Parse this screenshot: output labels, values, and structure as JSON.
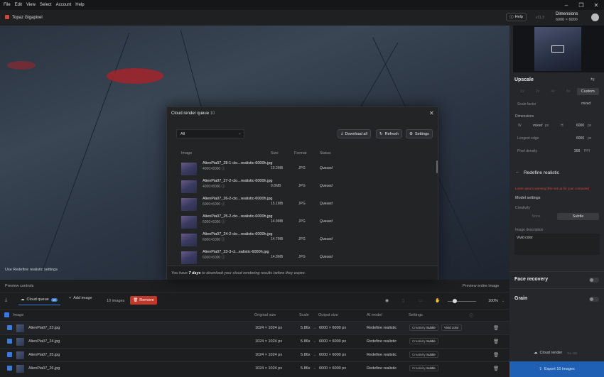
{
  "menu": [
    "File",
    "Edit",
    "View",
    "Select",
    "Account",
    "Help"
  ],
  "app": {
    "name": "Topaz Gigapixel",
    "help": "Help",
    "version": "v11.3",
    "dim_label": "Dimensions",
    "dim_value": "6000 × 6000"
  },
  "canvas": {
    "hint": "Use Redefine realistic settings"
  },
  "dialog": {
    "title": "Cloud render queue",
    "count": "10",
    "filter": "All",
    "download_all": "Download all",
    "refresh": "Refresh",
    "settings": "Settings",
    "columns": {
      "image": "Image",
      "size": "Size",
      "format": "Format",
      "status": "Status"
    },
    "items": [
      {
        "name": "AlienPia07_28-1-clo...realistic-6000h.jpg",
        "res": "4000×8000",
        "size": "10.2MB",
        "fmt": "JPG",
        "status": "Queued"
      },
      {
        "name": "AlienPia07_27-2-clo...realistic-6000h.jpg",
        "res": "4000×8000",
        "size": "9.8MB",
        "fmt": "JPG",
        "status": "Queued"
      },
      {
        "name": "AlienPia07_26-2-clo...realistic-6000h.jpg",
        "res": "6000×6000",
        "size": "15.1MB",
        "fmt": "JPG",
        "status": "Queued"
      },
      {
        "name": "AlienPia07_25-2-clo...realistic-6000h.jpg",
        "res": "6000×6000",
        "size": "14.8MB",
        "fmt": "JPG",
        "status": "Queued"
      },
      {
        "name": "AlienPia07_24-2-clo...realistic-6000h.jpg",
        "res": "6000×6000",
        "size": "14.7MB",
        "fmt": "JPG",
        "status": "Queued"
      },
      {
        "name": "AlienPia07_23-3-cl...ealistic-6000h.jpg",
        "res": "6000×6000",
        "size": "14.8MB",
        "fmt": "JPG",
        "status": "Queued"
      }
    ],
    "footer_pre": "You have ",
    "footer_days": "7 days",
    "footer_post": " to download your cloud rendering results before they expire."
  },
  "right": {
    "upscale": "Upscale",
    "presets": [
      "1x",
      "2x",
      "4x",
      "6x"
    ],
    "custom": "Custom",
    "scale_factor": "Scale factor",
    "scale_value": "mixed",
    "dimensions": "Dimensions",
    "w": "W",
    "w_val": "mixed",
    "w_unit": "px",
    "h": "H",
    "h_val": "6000",
    "h_unit": "px",
    "longest": "Longest edge",
    "longest_val": "6000",
    "longest_unit": "px",
    "density": "Pixel density",
    "density_val": "300",
    "density_unit": "PPI",
    "model": "Redefine realistic",
    "warning": "Lorem ipsum warning (this set up for your computer)",
    "model_settings": "Model settings",
    "creativity": "Creativity",
    "cr_none": "None",
    "cr_subtle": "Subtle",
    "img_desc": "Image description",
    "img_desc_val": "Vivid color",
    "face": "Face recovery",
    "grain": "Grain",
    "cloud_render": "Cloud render",
    "cloud_credits": "No 42s",
    "export": "Export 10 images"
  },
  "bottom": {
    "preview_controls": "Preview controls",
    "preview_entire": "Preview entire image",
    "cloud_queue": "Cloud queue",
    "cloud_count": "10",
    "add_image": "Add image",
    "images": "10 images",
    "remove": "Remove",
    "zoom": "100%",
    "cols": {
      "image": "Image",
      "orig": "Original size",
      "scale": "Scale",
      "output": "Output size",
      "model": "AI model",
      "settings": "Settings"
    },
    "rows": [
      {
        "name": "AlienPia07_23.jpg",
        "orig": "1024 × 1024 px",
        "scale": "5.86x",
        "output": "6000 × 6000 px",
        "model": "Redefine realistic",
        "set1": "Creativity",
        "set2": "Subtle",
        "set3": "Vivid color"
      },
      {
        "name": "AlienPia07_24.jpg",
        "orig": "1024 × 1024 px",
        "scale": "5.86x",
        "output": "6000 × 6000 px",
        "model": "Redefine realistic",
        "set1": "Creativity",
        "set2": "Subtle",
        "set3": ""
      },
      {
        "name": "AlienPia07_25.jpg",
        "orig": "1024 × 1024 px",
        "scale": "5.86x",
        "output": "6000 × 6000 px",
        "model": "Redefine realistic",
        "set1": "Creativity",
        "set2": "Subtle",
        "set3": ""
      },
      {
        "name": "AlienPia07_26.jpg",
        "orig": "1024 × 1024 px",
        "scale": "5.86x",
        "output": "6000 × 6000 px",
        "model": "Redefine realistic",
        "set1": "Creativity",
        "set2": "Subtle",
        "set3": ""
      }
    ]
  },
  "colors": {
    "accent": "#3b7bd8",
    "remove": "#c0392b",
    "warning": "#d2433c",
    "export": "#1f5fb4"
  }
}
